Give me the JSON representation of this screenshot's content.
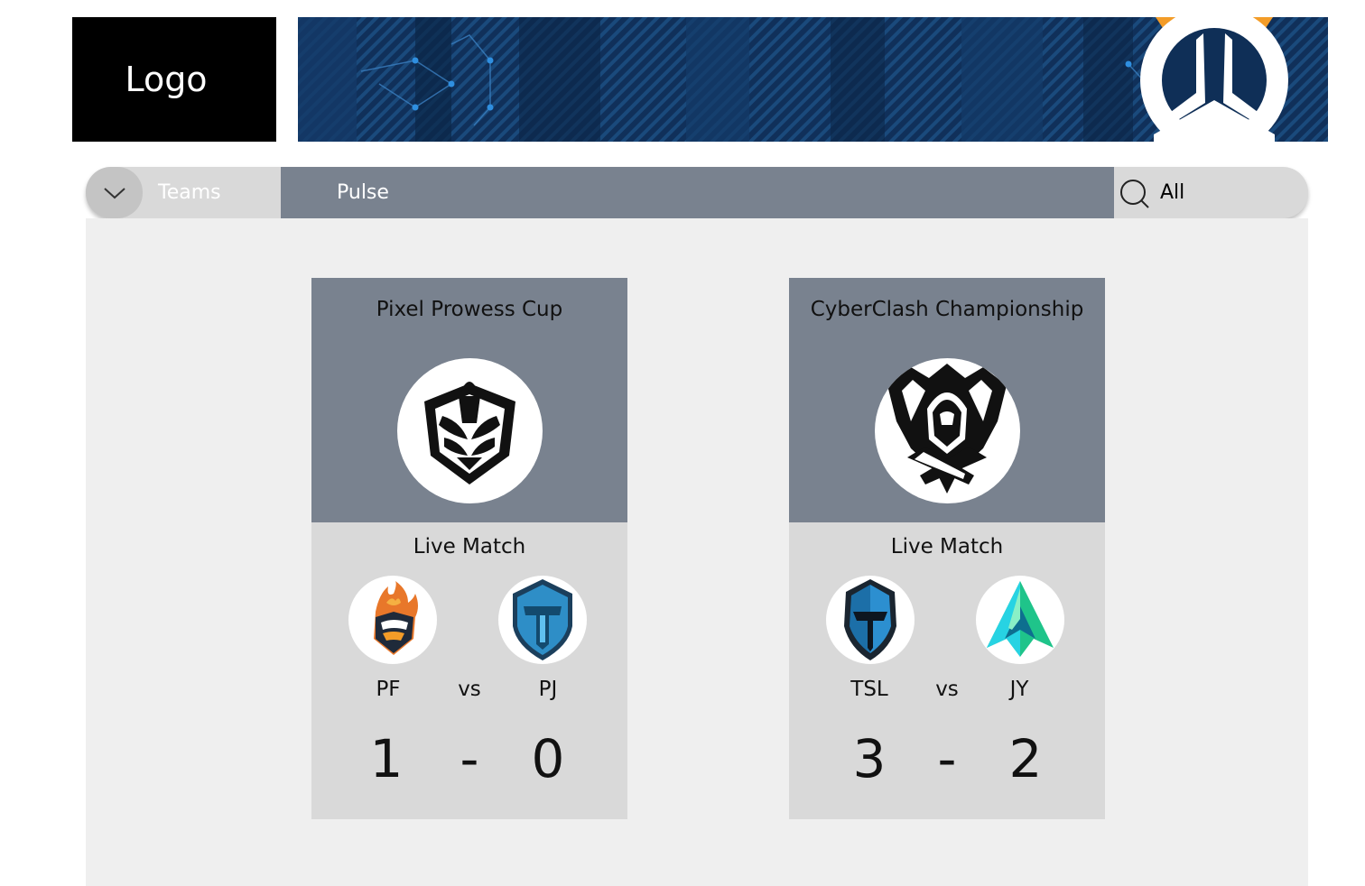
{
  "header": {
    "logo_text": "Logo",
    "banner_icon": "overwatch-emblem-icon"
  },
  "nav": {
    "teams_label": "Teams",
    "pulse_label": "Pulse",
    "filter_label": "All",
    "toggle_icon": "chevron-down-icon",
    "search_icon": "search-icon"
  },
  "matches": [
    {
      "title": "Pixel Prowess Cup",
      "tournament_icon": "trophy-wings-emblem-icon",
      "status": "Live Match",
      "team_a": {
        "name": "PF",
        "icon": "flame-shield-icon",
        "score": "1"
      },
      "vs": "vs",
      "separator": "-",
      "team_b": {
        "name": "PJ",
        "icon": "blue-shield-icon",
        "score": "0"
      }
    },
    {
      "title": "CyberClash Championship",
      "tournament_icon": "hooded-figure-emblem-icon",
      "status": "Live Match",
      "team_a": {
        "name": "TSL",
        "icon": "knight-helmet-icon",
        "score": "3"
      },
      "vs": "vs",
      "separator": "-",
      "team_b": {
        "name": "JY",
        "icon": "green-arrow-icon",
        "score": "2"
      }
    }
  ],
  "colors": {
    "card_header": "#79828f",
    "card_body": "#d9d9d9",
    "banner": "#0f2f57",
    "overwatch_orange": "#f39c28"
  }
}
